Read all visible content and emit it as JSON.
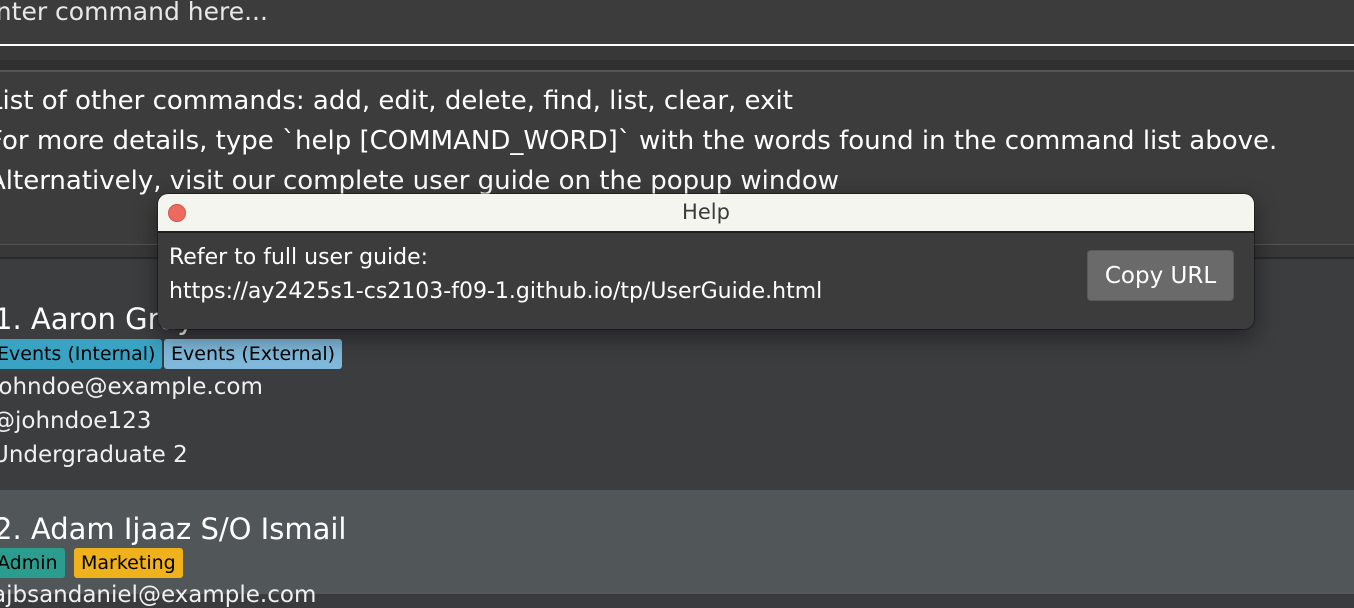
{
  "command_box": {
    "placeholder": "Enter command here..."
  },
  "result_display": {
    "lines": [
      "List of other commands: add, edit, delete, find, list, clear, exit",
      "For more details, type `help [COMMAND_WORD]` with the words found in the command list above.",
      "Alternatively, visit our complete user guide on the popup window"
    ]
  },
  "persons": [
    {
      "name": "1. Aaron Gray",
      "tags": [
        {
          "label": "Events (Internal)",
          "color": "#3aa3c4"
        },
        {
          "label": "Events (External)",
          "color": "#7fb8da"
        }
      ],
      "email": "johndoe@example.com",
      "telegram": "@johndoe123",
      "year": "Undergraduate 2"
    },
    {
      "name": "2. Adam Ijaaz S/O Ismail",
      "tags": [
        {
          "label": "Admin",
          "color": "#2a9d8f"
        },
        {
          "label": "Marketing",
          "color": "#f0b21c"
        }
      ],
      "email": "ajbsandaniel@example.com"
    }
  ],
  "help_window": {
    "title": "Help",
    "text_line1": "Refer to full user guide:",
    "url": "https://ay2425s1-cs2103-f09-1.github.io/tp/UserGuide.html",
    "copy_button": "Copy URL"
  }
}
